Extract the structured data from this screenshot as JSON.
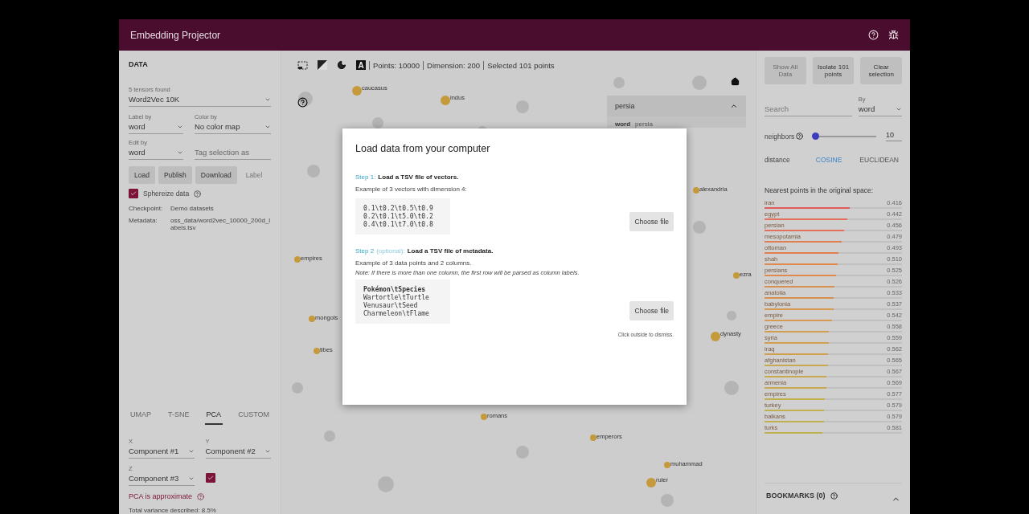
{
  "header": {
    "title": "Embedding Projector"
  },
  "data_panel": {
    "title": "DATA",
    "tensor_select": {
      "label": "5 tensors found",
      "value": "Word2Vec 10K"
    },
    "label_by": {
      "label": "Label by",
      "value": "word"
    },
    "color_by": {
      "label": "Color by",
      "value": "No color map"
    },
    "edit_by": {
      "label": "Edit by",
      "value": "word"
    },
    "tag_field": {
      "placeholder": "Tag selection as"
    },
    "buttons": [
      {
        "label": "Load",
        "disabled": false
      },
      {
        "label": "Publish",
        "disabled": false
      },
      {
        "label": "Download",
        "disabled": false
      },
      {
        "label": "Label",
        "disabled": true
      }
    ],
    "sphereize": {
      "label": "Sphereize data",
      "checked": true
    },
    "info": [
      {
        "key": "Checkpoint:",
        "value": "Demo datasets"
      },
      {
        "key": "Metadata:",
        "value": "oss_data/word2vec_10000_200d_labels.tsv"
      }
    ]
  },
  "projection": {
    "tabs": [
      {
        "label": "UMAP",
        "selected": false
      },
      {
        "label": "T-SNE",
        "selected": false
      },
      {
        "label": "PCA",
        "selected": true
      },
      {
        "label": "CUSTOM",
        "selected": false
      }
    ],
    "x": {
      "label": "X",
      "value": "Component #1"
    },
    "y": {
      "label": "Y",
      "value": "Component #2"
    },
    "z": {
      "label": "Z",
      "value": "Component #3"
    },
    "z_enabled": true,
    "note": "PCA is approximate",
    "variance": "Total variance described: 8.5%"
  },
  "toolbar": {
    "icon_letter": "A",
    "status": [
      "Points: 10000",
      "Dimension: 200",
      "Selected 101 points"
    ]
  },
  "points": [
    {
      "label": "caucasus"
    },
    {
      "label": "indus"
    },
    {
      "label": "alexandria"
    },
    {
      "label": "empires"
    },
    {
      "label": "mongols"
    },
    {
      "label": "tibes"
    },
    {
      "label": "ezra"
    },
    {
      "label": "dynasty"
    },
    {
      "label": "romans"
    },
    {
      "label": "emperors"
    },
    {
      "label": "muhammad"
    },
    {
      "label": "ruler"
    }
  ],
  "inspector_card": {
    "title": "persia",
    "expanded": true,
    "key": "word",
    "value": "persia"
  },
  "modal": {
    "title": "Load data from your computer",
    "steps": [
      {
        "step": "Step 1:",
        "title": "Load a TSV file of vectors.",
        "desc": "Example of 3 vectors with dimension 4:",
        "lines": [
          "0.1\\t0.2\\t0.5\\t0.9",
          "0.2\\t0.1\\t5.0\\t0.2",
          "0.4\\t0.1\\t7.0\\t0.8"
        ],
        "button": "Choose file"
      },
      {
        "step": "Step 2",
        "optional": "(optional):",
        "title": "Load a TSV file of metadata.",
        "desc": "Example of 3 data points and 2 columns.",
        "note": "Note: If there is more than one column, the first row will be parsed as column labels.",
        "lines": [
          "Pokémon\\tSpecies",
          "Wartortle\\tTurtle",
          "Venusaur\\tSeed",
          "Charmeleon\\tFlame"
        ],
        "button": "Choose file"
      }
    ],
    "dismiss": "Click outside to dismiss."
  },
  "right_panel": {
    "buttons": [
      {
        "label": "Show All Data",
        "disabled": true
      },
      {
        "label": "Isolate 101 points",
        "disabled": false
      },
      {
        "label": "Clear selection",
        "disabled": false
      }
    ],
    "search": {
      "placeholder": "Search"
    },
    "by": {
      "label": "By",
      "value": "word"
    },
    "neighbors": {
      "label": "neighbors",
      "level": 0.03,
      "value": "10"
    },
    "distance": {
      "label": "distance",
      "options": [
        {
          "label": "COSINE",
          "selected": true
        },
        {
          "label": "EUCLIDEAN",
          "selected": false
        }
      ]
    },
    "nearest_title": "Nearest points in the original space:",
    "nearest": [
      {
        "word": "iran",
        "value": "0.416",
        "level": 0.62,
        "color": "#e05a5a"
      },
      {
        "word": "egypt",
        "value": "0.442",
        "level": 0.6,
        "color": "#e2705a"
      },
      {
        "word": "persian",
        "value": "0.456",
        "level": 0.58,
        "color": "#e2705a"
      },
      {
        "word": "mesopotamia",
        "value": "0.479",
        "level": 0.56,
        "color": "#e08050"
      },
      {
        "word": "ottoman",
        "value": "0.493",
        "level": 0.54,
        "color": "#e08050"
      },
      {
        "word": "shah",
        "value": "0.510",
        "level": 0.53,
        "color": "#e08a50"
      },
      {
        "word": "persians",
        "value": "0.525",
        "level": 0.52,
        "color": "#e08a50"
      },
      {
        "word": "conquered",
        "value": "0.526",
        "level": 0.51,
        "color": "#d89050"
      },
      {
        "word": "anatolia",
        "value": "0.533",
        "level": 0.5,
        "color": "#d89050"
      },
      {
        "word": "babylonia",
        "value": "0.537",
        "level": 0.5,
        "color": "#d89a50"
      },
      {
        "word": "empire",
        "value": "0.542",
        "level": 0.49,
        "color": "#d89a50"
      },
      {
        "word": "greece",
        "value": "0.558",
        "level": 0.47,
        "color": "#d0a050"
      },
      {
        "word": "syria",
        "value": "0.559",
        "level": 0.47,
        "color": "#d0a050"
      },
      {
        "word": "iraq",
        "value": "0.562",
        "level": 0.46,
        "color": "#d0a050"
      },
      {
        "word": "afghanistan",
        "value": "0.565",
        "level": 0.46,
        "color": "#c8a850"
      },
      {
        "word": "constantinople",
        "value": "0.567",
        "level": 0.45,
        "color": "#c8a850"
      },
      {
        "word": "armenia",
        "value": "0.569",
        "level": 0.45,
        "color": "#c8a850"
      },
      {
        "word": "empires",
        "value": "0.577",
        "level": 0.44,
        "color": "#c0b050"
      },
      {
        "word": "turkey",
        "value": "0.579",
        "level": 0.43,
        "color": "#c0b050"
      },
      {
        "word": "balkans",
        "value": "0.579",
        "level": 0.43,
        "color": "#c0b050"
      },
      {
        "word": "turks",
        "value": "0.581",
        "level": 0.42,
        "color": "#c0b050"
      }
    ]
  },
  "bookmarks": {
    "title": "BOOKMARKS (0)",
    "expanded": false
  }
}
